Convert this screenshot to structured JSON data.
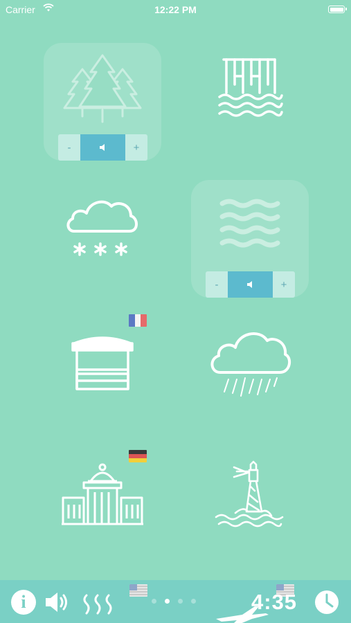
{
  "status_bar": {
    "carrier": "Carrier",
    "time": "12:22 PM"
  },
  "tiles": [
    {
      "name": "forest",
      "icon": "forest-icon",
      "active": true,
      "volume": {
        "minus": "-",
        "plus": "+"
      }
    },
    {
      "name": "waterfall",
      "icon": "waterfall-icon",
      "active": false
    },
    {
      "name": "snow",
      "icon": "snow-cloud-icon",
      "active": false
    },
    {
      "name": "waves",
      "icon": "waves-icon",
      "active": true,
      "volume": {
        "minus": "-",
        "plus": "+"
      }
    },
    {
      "name": "market",
      "icon": "market-stall-icon",
      "active": false,
      "flag": "france-flag"
    },
    {
      "name": "rain",
      "icon": "rain-cloud-icon",
      "active": false
    },
    {
      "name": "building",
      "icon": "government-building-icon",
      "active": false,
      "flag": "germany-flag"
    },
    {
      "name": "lighthouse",
      "icon": "lighthouse-icon",
      "active": false
    }
  ],
  "bottom_bar": {
    "info_label": "i",
    "timer": "4:35",
    "page_dots": 4,
    "current_page": 2,
    "flags": [
      "usa-flag",
      "usa-flag"
    ]
  },
  "colors": {
    "background": "#8fdbc0",
    "bottom_bar": "#7ad0c5",
    "volume_accent": "#5cbace",
    "volume_side": "#c4ece3"
  }
}
